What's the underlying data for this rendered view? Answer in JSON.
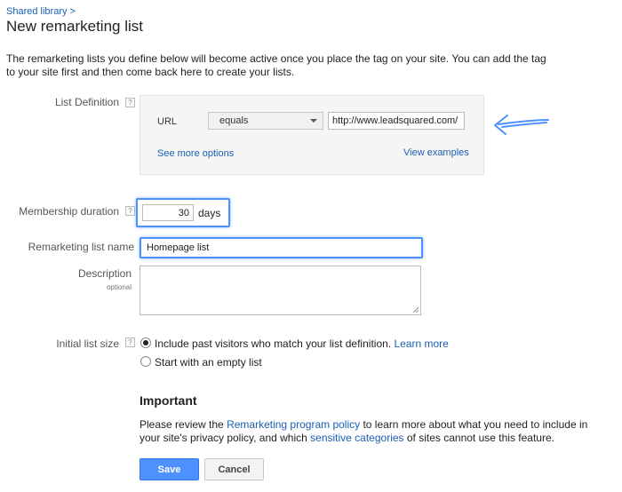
{
  "breadcrumb": "Shared library >",
  "title": "New remarketing list",
  "intro": "The remarketing lists you define below will become active once you place the tag on your site. You can add the tag to your site first and then come back here to create your lists.",
  "list_definition": {
    "label": "List Definition",
    "field": "URL",
    "operator": "equals",
    "url_value": "http://www.leadsquared.com/",
    "see_more": "See more options",
    "view_examples": "View examples"
  },
  "membership": {
    "label": "Membership duration",
    "value": "30",
    "unit": "days"
  },
  "list_name": {
    "label": "Remarketing list name",
    "value": "Homepage list"
  },
  "description": {
    "label": "Description",
    "sublabel": "optional",
    "value": ""
  },
  "initial_size": {
    "label": "Initial list size",
    "option1": "Include past visitors who match your list definition.",
    "option1_link": "Learn more",
    "option2": "Start with an empty list",
    "selected": "option1"
  },
  "important": {
    "heading": "Important",
    "text1": "Please review the ",
    "link1": "Remarketing program policy",
    "text2": " to learn more about what you need to include in your site's privacy policy, and which ",
    "link2": "sensitive categories",
    "text3": " of sites cannot use this feature."
  },
  "buttons": {
    "save": "Save",
    "cancel": "Cancel"
  },
  "help_glyph": "?",
  "accent_color": "#4d90fe"
}
